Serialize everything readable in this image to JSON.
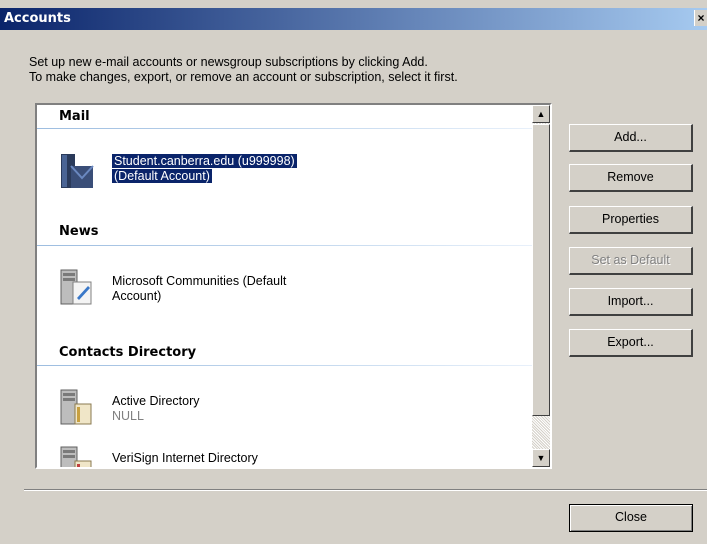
{
  "window": {
    "title": "Accounts",
    "close_glyph": "×"
  },
  "instructions": [
    "Set up new e-mail accounts or newsgroup subscriptions by clicking Add.",
    "To make changes, export, or remove an account or subscription, select it first."
  ],
  "groups": {
    "mail": {
      "header": "Mail",
      "items": [
        {
          "line1": "Student.canberra.edu (u999998)",
          "line2": "(Default Account)",
          "icon": "mail-account-icon",
          "selected": true
        }
      ]
    },
    "news": {
      "header": "News",
      "items": [
        {
          "line1": "Microsoft Communities (Default",
          "line2": "Account)",
          "icon": "news-server-icon"
        }
      ]
    },
    "contacts": {
      "header": "Contacts Directory",
      "items": [
        {
          "line1": "Active Directory",
          "line2": "NULL",
          "icon": "directory-server-icon"
        },
        {
          "line1": "VeriSign Internet Directory",
          "line2": "",
          "icon": "directory-server-icon"
        }
      ]
    }
  },
  "scrollbar": {
    "up_glyph": "▲",
    "down_glyph": "▼"
  },
  "buttons": {
    "add": "Add...",
    "remove": "Remove",
    "properties": "Properties",
    "set_default": "Set as Default",
    "import": "Import...",
    "export": "Export...",
    "close": "Close"
  },
  "colors": {
    "titlebar_start": "#0a246a",
    "titlebar_end": "#a6caf0",
    "selection": "#0a246a",
    "face": "#d4d0c8"
  }
}
